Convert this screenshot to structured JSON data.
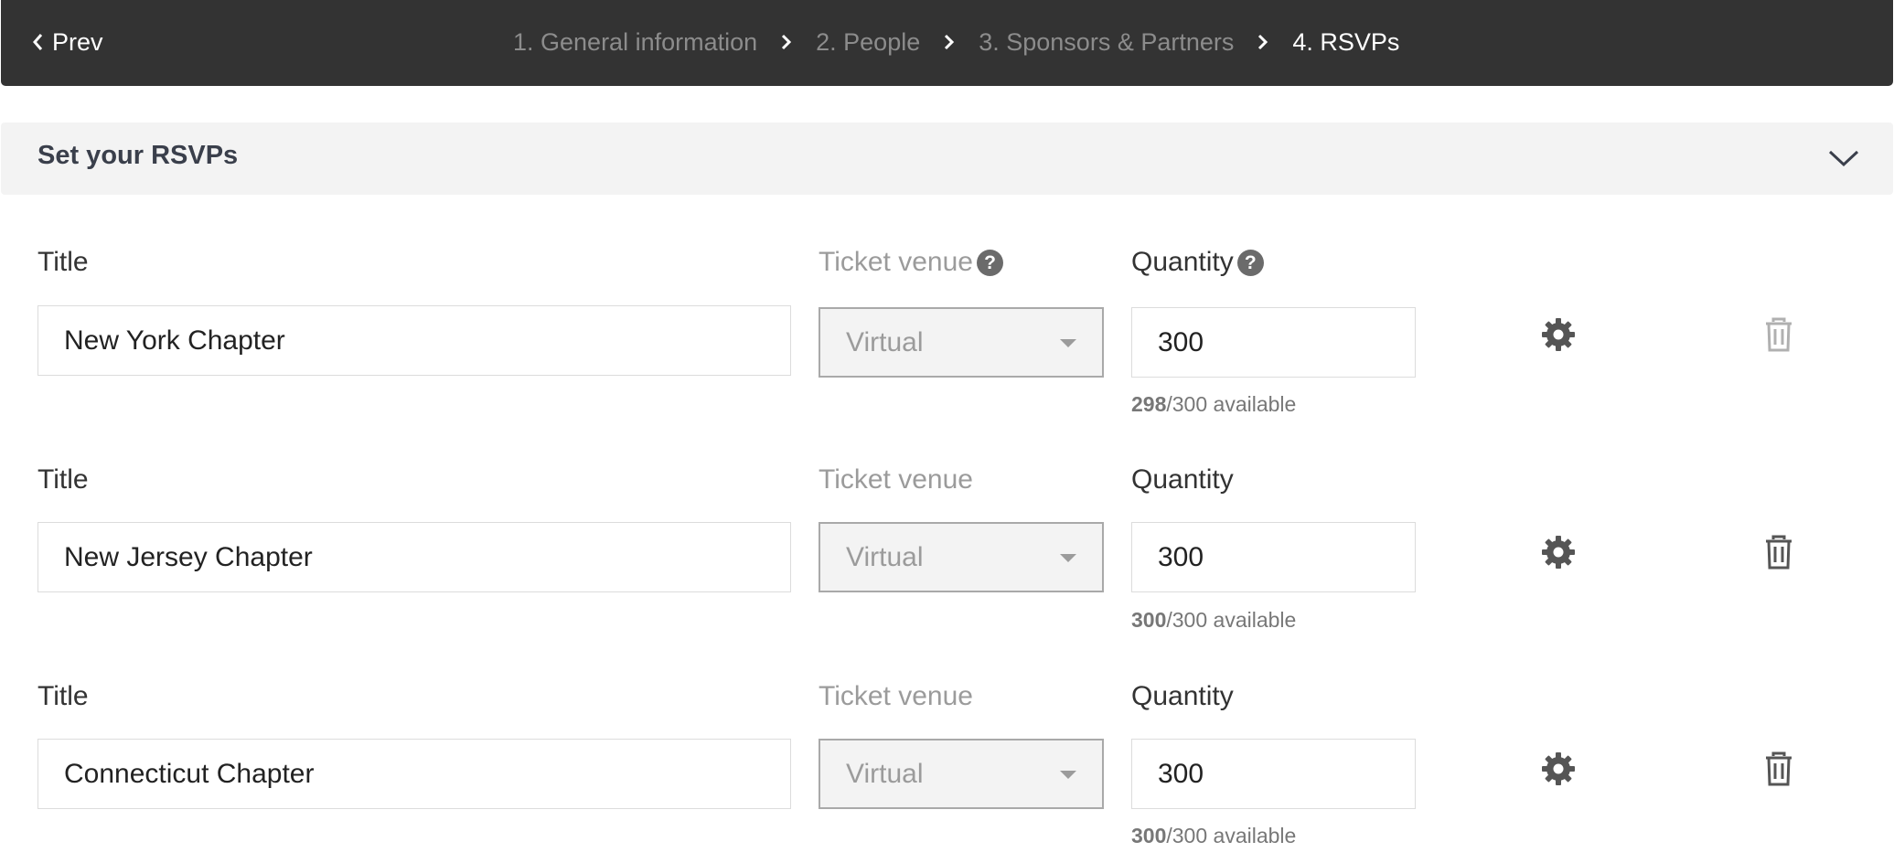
{
  "nav": {
    "prev_label": "Prev",
    "steps": [
      {
        "label": "1. General information",
        "active": false
      },
      {
        "label": "2. People",
        "active": false
      },
      {
        "label": "3. Sponsors & Partners",
        "active": false
      },
      {
        "label": "4. RSVPs",
        "active": true
      }
    ]
  },
  "section": {
    "title": "Set your RSVPs"
  },
  "labels": {
    "title": "Title",
    "ticket_venue": "Ticket venue",
    "quantity": "Quantity",
    "help_glyph": "?",
    "available_suffix": "available"
  },
  "rsvps": [
    {
      "title": "New York Chapter",
      "venue": "Virtual",
      "quantity": "300",
      "available": "298",
      "total": "300"
    },
    {
      "title": "New Jersey Chapter",
      "venue": "Virtual",
      "quantity": "300",
      "available": "300",
      "total": "300"
    },
    {
      "title": "Connecticut Chapter",
      "venue": "Virtual",
      "quantity": "300",
      "available": "300",
      "total": "300"
    }
  ],
  "icons": {
    "prev": "chevron-left-icon",
    "step_separator": "chevron-right-icon",
    "collapse": "chevron-down-icon",
    "settings": "gear-icon",
    "delete": "trash-icon",
    "help": "question-circle-icon"
  },
  "colors": {
    "topbar_bg": "#333333",
    "section_bg": "#f3f3f3",
    "active_step": "#ffffff",
    "inactive_step": "#8c8c8c",
    "first_delete_icon": "#b0b0b0",
    "delete_icon": "#555555"
  }
}
